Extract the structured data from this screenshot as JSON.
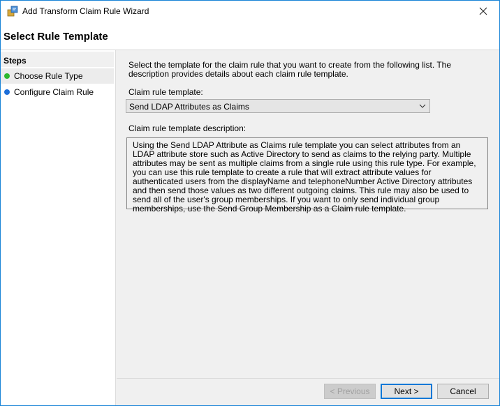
{
  "window": {
    "title": "Add Transform Claim Rule Wizard",
    "app_icon": "wizard-icon",
    "close_icon": "close-icon"
  },
  "header": {
    "title": "Select Rule Template"
  },
  "sidebar": {
    "heading": "Steps",
    "items": [
      {
        "label": "Choose Rule Type",
        "status_color": "#2eb82e",
        "active": true
      },
      {
        "label": "Configure Claim Rule",
        "status_color": "#1e6fd9",
        "active": false
      }
    ]
  },
  "main": {
    "intro": "Select the template for the claim rule that you want to create from the following list. The description provides details about each claim rule template.",
    "template_label": "Claim rule template:",
    "template_selected": "Send LDAP Attributes as Claims",
    "description_label": "Claim rule template description:",
    "description": "Using the Send LDAP Attribute as Claims rule template you can select attributes from an LDAP attribute store such as Active Directory to send as claims to the relying party. Multiple attributes may be sent as multiple claims from a single rule using this rule type. For example, you can use this rule template to create a rule that will extract attribute values for authenticated users from the displayName and telephoneNumber Active Directory attributes and then send those values as two different outgoing claims. This rule may also be used to send all of the user's group memberships. If you want to only send individual group memberships, use the Send Group Membership as a Claim rule template."
  },
  "footer": {
    "previous_label": "< Previous",
    "next_label": "Next >",
    "cancel_label": "Cancel"
  }
}
